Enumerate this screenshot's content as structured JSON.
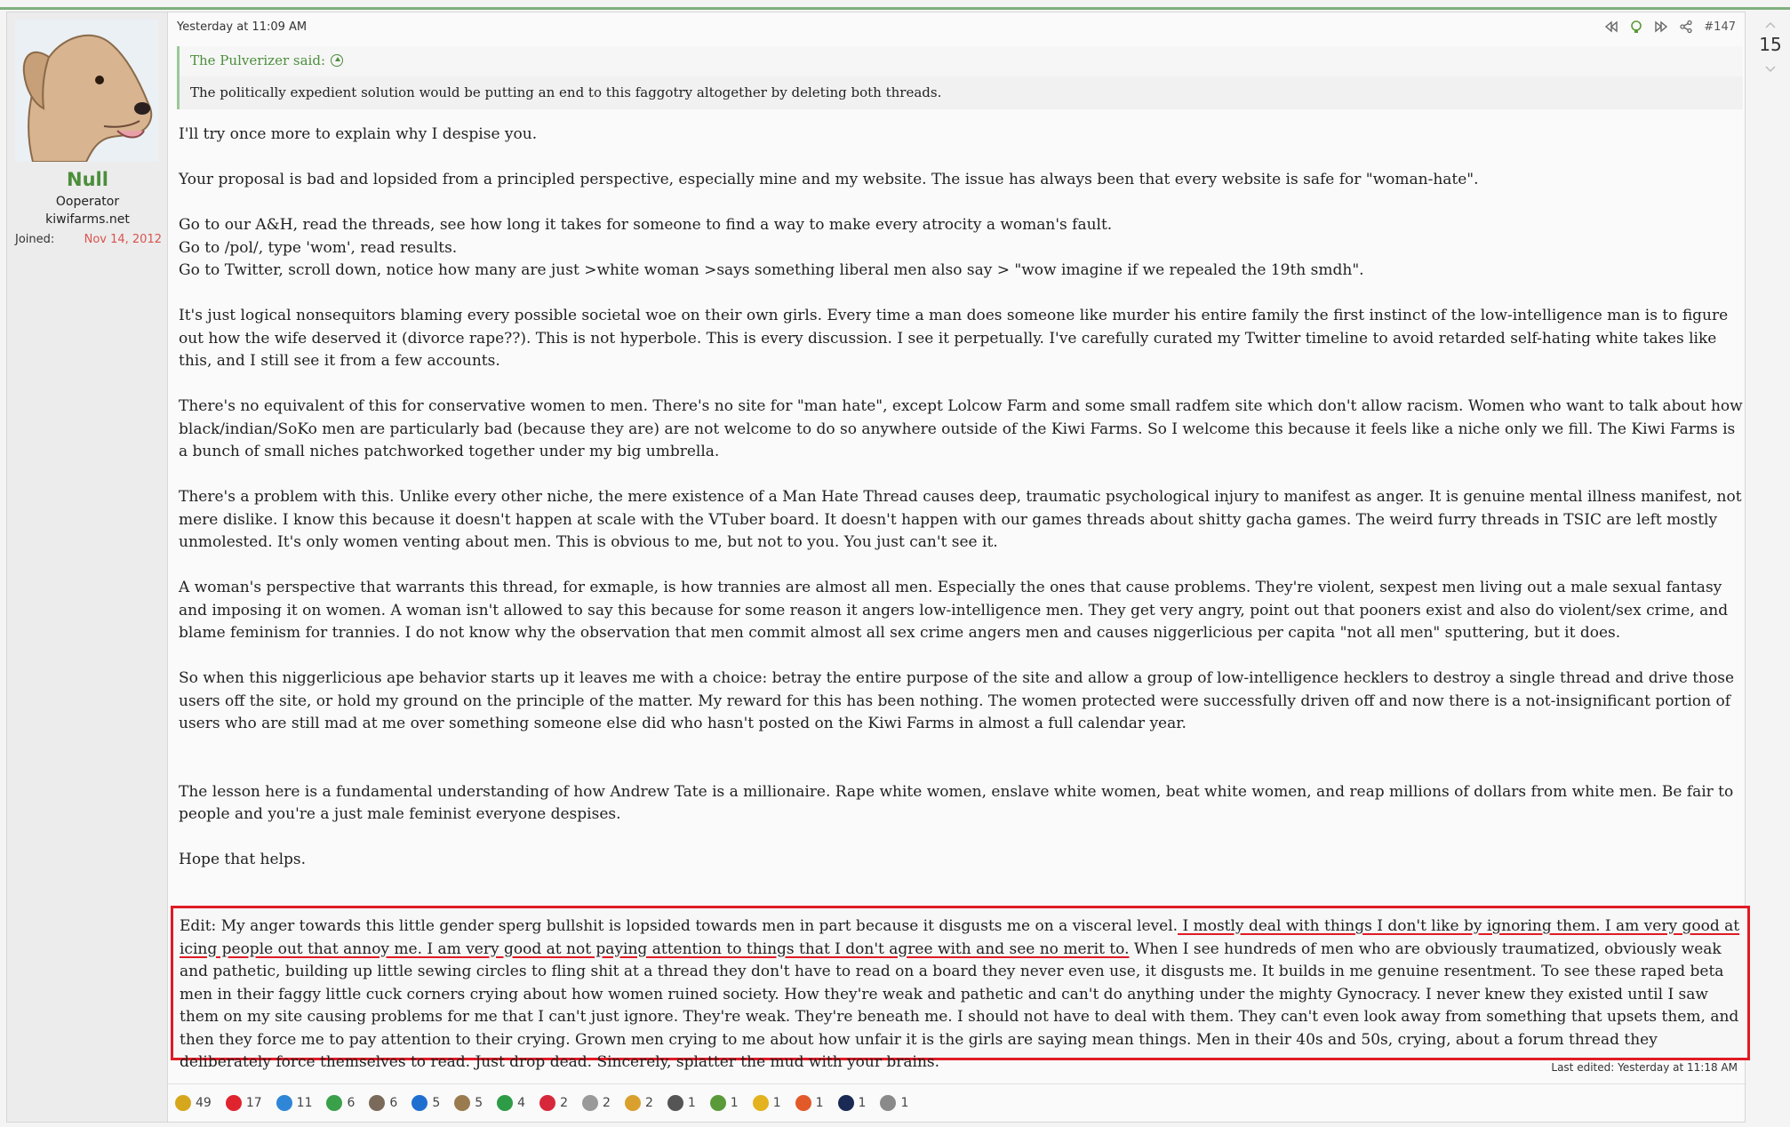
{
  "user": {
    "name": "Null",
    "title": "Ooperator",
    "site": "kiwifarms.net",
    "joined_label": "Joined:",
    "joined_date": "Nov 14, 2012"
  },
  "post": {
    "timestamp": "Yesterday at 11:09 AM",
    "number": "#147",
    "quote_author": "The Pulverizer said:",
    "quote_text": "The politically expedient solution would be putting an end to this faggotry altogether by deleting both threads.",
    "paragraphs": [
      "I'll try once more to explain why I despise you.",
      "Your proposal is bad and lopsided from a principled perspective, especially mine and my website. The issue has always been that every website is safe for \"woman-hate\".",
      "Go to our A&H, read the threads, see how long it takes for someone to find a way to make every atrocity a woman's fault.",
      "Go to /pol/, type 'wom', read results.",
      "Go to Twitter, scroll down, notice how many are just >white woman >says something liberal men also say > \"wow imagine if we repealed the 19th smdh\".",
      "It's just logical nonsequitors blaming every possible societal woe on their own girls. Every time a man does someone like murder his entire family the first instinct of the low-intelligence man is to figure out how the wife deserved it (divorce rape??). This is not hyperbole. This is every discussion. I see it perpetually. I've carefully curated my Twitter timeline to avoid retarded self-hating white takes like this, and I still see it from a few accounts.",
      "There's no equivalent of this for conservative women to men. There's no site for \"man hate\", except Lolcow Farm and some small radfem site which don't allow racism. Women who want to talk about how black/indian/SoKo men are particularly bad (because they are) are not welcome to do so anywhere outside of the Kiwi Farms. So I welcome this because it feels like a niche only we fill. The Kiwi Farms is a bunch of small niches patchworked together under my big umbrella.",
      "There's a problem with this. Unlike every other niche, the mere existence of a Man Hate Thread causes deep, traumatic psychological injury to manifest as anger. It is genuine mental illness manifest, not mere dislike. I know this because it doesn't happen at scale with the VTuber board. It doesn't happen with our games threads about shitty gacha games. The weird furry threads in TSIC are left mostly unmolested. It's only women venting about men. This is obvious to me, but not to you. You just can't see it.",
      "A woman's perspective that warrants this thread, for exmaple, is how trannies are almost all men. Especially the ones that cause problems. They're violent, sexpest men living out a male sexual fantasy and imposing it on women. A woman isn't allowed to say this because for some reason it angers low-intelligence men. They get very angry, point out that pooners exist and also do violent/sex crime, and blame feminism for trannies. I do not know why the observation that men commit almost all sex crime angers men and causes niggerlicious per capita \"not all men\" sputtering, but it does.",
      "So when this niggerlicious ape behavior starts up it leaves me with a choice: betray the entire purpose of the site and allow a group of low-intelligence hecklers to destroy a single thread and drive those users off the site, or hold my ground on the principle of the matter. My reward for this has been nothing. The women protected were successfully driven off and now there is a not-insignificant portion of users who are still mad at me over something someone else did who hasn't posted on the Kiwi Farms in almost a full calendar year.",
      "The lesson here is a fundamental understanding of how Andrew Tate is a millionaire. Rape white women, enslave white women, beat white women, and reap millions of dollars from white men. Be fair to people and you're a just male feminist everyone despises.",
      "Hope that helps."
    ],
    "edit_part1": "Edit: My anger towards this little gender sperg bullshit is lopsided towards men in part because it disgusts me on a visceral level.",
    "edit_highlight": " I mostly deal with things I don't like by ignoring them. I am very good at icing people out that annoy me. I am very good at not paying attention to things that I don't agree with and see no merit to.",
    "edit_part2": " When I see hundreds of men who are obviously traumatized, obviously weak and pathetic, building up little sewing circles to fling shit at a thread they don't have to read on a board they never even use, it disgusts me. It builds in me genuine resentment. To see these raped beta men in their faggy little cuck corners crying about how women ruined society. How they're weak and pathetic and can't do anything under the mighty Gynocracy. I never knew they existed until I saw them on my site causing problems for me that I can't just ignore. They're weak. They're beneath me. I should not have to deal with them. They can't even look away from something that upsets them, and then they force me to pay attention to their crying. Grown men crying to me about how unfair it is the girls are saying mean things. Men in their 40s and 50s, crying, about a forum thread they deliberately force themselves to read. Just drop dead. Sincerely, splatter the mud with your brains.",
    "last_edited": "Last edited: Yesterday at 11:18 AM"
  },
  "vote": {
    "count": "15"
  },
  "reactions": [
    {
      "icon": "coin-stack-icon",
      "color": "#d6a71c",
      "count": "49"
    },
    {
      "icon": "heart-icon",
      "color": "#e0242f",
      "count": "17"
    },
    {
      "icon": "thumbs-up-icon",
      "color": "#2f86d6",
      "count": "11"
    },
    {
      "icon": "winner-icon",
      "color": "#3aa04a",
      "count": "6"
    },
    {
      "icon": "face-icon",
      "color": "#7a6a5a",
      "count": "6"
    },
    {
      "icon": "info-icon",
      "color": "#1f6fd0",
      "count": "5"
    },
    {
      "icon": "horse-icon",
      "color": "#9a7b4f",
      "count": "5"
    },
    {
      "icon": "check-icon",
      "color": "#2e9b47",
      "count": "4"
    },
    {
      "icon": "cross-icon",
      "color": "#d6283a",
      "count": "2"
    },
    {
      "icon": "statue-icon",
      "color": "#9a9a9a",
      "count": "2"
    },
    {
      "icon": "rainbow-pinwheel-icon",
      "color": "#d9a02e",
      "count": "2"
    },
    {
      "icon": "speech-bubble-icon",
      "color": "#555555",
      "count": "1"
    },
    {
      "icon": "bird-icon",
      "color": "#5a9a3a",
      "count": "1"
    },
    {
      "icon": "thinking-icon",
      "color": "#e3b21e",
      "count": "1"
    },
    {
      "icon": "rainbow-icon",
      "color": "#e35a2a",
      "count": "1"
    },
    {
      "icon": "hat-icon",
      "color": "#1a2a55",
      "count": "1"
    },
    {
      "icon": "tag-icon",
      "color": "#8a8a8a",
      "count": "1"
    }
  ]
}
